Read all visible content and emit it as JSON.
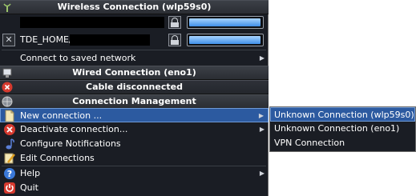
{
  "menu": {
    "wireless_header": "Wireless Connection (wlp59s0)",
    "networks": [
      {
        "name": "",
        "signal": 0.99
      },
      {
        "name": "TDE_HOME/",
        "signal": 0.99
      }
    ],
    "connect_saved": "Connect to saved network",
    "wired_header": "Wired Connection (eno1)",
    "cable_status": "Cable disconnected",
    "management_header": "Connection Management",
    "items": [
      {
        "label": "New connection ...",
        "icon": "new-connection-icon",
        "submenu": true
      },
      {
        "label": "Deactivate connection...",
        "icon": "deactivate-icon",
        "submenu": true
      },
      {
        "label": "Configure Notifications",
        "icon": "notifications-icon",
        "submenu": false
      },
      {
        "label": "Edit Connections",
        "icon": "edit-icon",
        "submenu": false
      }
    ],
    "help": "Help",
    "quit": "Quit"
  },
  "submenu": {
    "items": [
      "Unknown Connection (wlp59s0)",
      "Unknown Connection (eno1)",
      "VPN Connection"
    ]
  },
  "colors": {
    "menu_bg": "#1a1d24",
    "highlight": "#2c5aa0"
  }
}
